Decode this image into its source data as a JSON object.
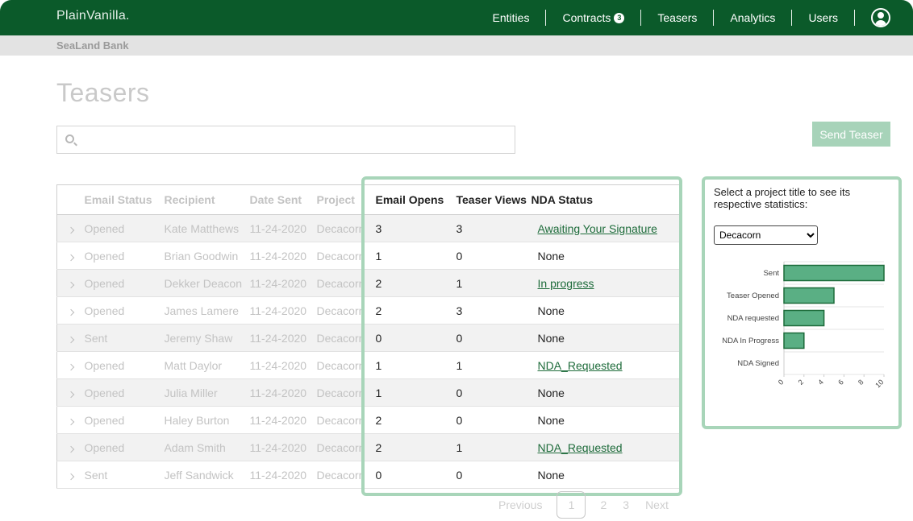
{
  "app": {
    "brand": "PlainVanilla."
  },
  "nav": {
    "links": [
      "Entities",
      "Contracts",
      "Teasers",
      "Analytics",
      "Users"
    ],
    "contracts_badge": "3"
  },
  "org": {
    "name": "SeaLand Bank"
  },
  "page": {
    "title": "Teasers"
  },
  "search": {
    "placeholder": "",
    "value": ""
  },
  "actions": {
    "send_teaser": "Send Teaser"
  },
  "table": {
    "columns": [
      "Email Status",
      "Recipient",
      "Date Sent",
      "Project",
      "Email Opens",
      "Teaser Views",
      "NDA Status"
    ],
    "rows": [
      {
        "status": "Opened",
        "recipient": "Kate Matthews",
        "date": "11-24-2020",
        "project": "Decacorn",
        "opens": "3",
        "views": "3",
        "nda": "Awaiting Your Signature",
        "nda_link": true
      },
      {
        "status": "Opened",
        "recipient": "Brian Goodwin",
        "date": "11-24-2020",
        "project": "Decacorn",
        "opens": "1",
        "views": "0",
        "nda": "None",
        "nda_link": false
      },
      {
        "status": "Opened",
        "recipient": "Dekker Deacon",
        "date": "11-24-2020",
        "project": "Decacorn",
        "opens": "2",
        "views": "1",
        "nda": "In progress",
        "nda_link": true
      },
      {
        "status": "Opened",
        "recipient": "James Lamere",
        "date": "11-24-2020",
        "project": "Decacorn",
        "opens": "2",
        "views": "3",
        "nda": "None",
        "nda_link": false
      },
      {
        "status": "Sent",
        "recipient": "Jeremy Shaw",
        "date": "11-24-2020",
        "project": "Decacorn",
        "opens": "0",
        "views": "0",
        "nda": "None",
        "nda_link": false
      },
      {
        "status": "Opened",
        "recipient": "Matt Daylor",
        "date": "11-24-2020",
        "project": "Decacorn",
        "opens": "1",
        "views": "1",
        "nda": "NDA_Requested",
        "nda_link": true
      },
      {
        "status": "Opened",
        "recipient": "Julia Miller",
        "date": "11-24-2020",
        "project": "Decacorn",
        "opens": "1",
        "views": "0",
        "nda": "None",
        "nda_link": false
      },
      {
        "status": "Opened",
        "recipient": "Haley Burton",
        "date": "11-24-2020",
        "project": "Decacorn",
        "opens": "2",
        "views": "0",
        "nda": "None",
        "nda_link": false
      },
      {
        "status": "Opened",
        "recipient": "Adam Smith",
        "date": "11-24-2020",
        "project": "Decacorn",
        "opens": "2",
        "views": "1",
        "nda": "NDA_Requested",
        "nda_link": true
      },
      {
        "status": "Sent",
        "recipient": "Jeff Sandwick",
        "date": "11-24-2020",
        "project": "Decacorn",
        "opens": "0",
        "views": "0",
        "nda": "None",
        "nda_link": false
      }
    ]
  },
  "pagination": {
    "previous": "Previous",
    "pages": [
      "1",
      "2",
      "3"
    ],
    "current": "1",
    "next": "Next"
  },
  "stats": {
    "prompt": "Select a project title to see its respective statistics:",
    "selected_project": "Decacorn"
  },
  "colors": {
    "nav_bg": "#0b5a2a",
    "highlight": "#a8d5b9",
    "bar_fill": "#5aaf84",
    "bar_stroke": "#1d6b3a",
    "link": "#1d6b3a"
  },
  "chart_data": {
    "type": "bar",
    "orientation": "horizontal",
    "categories": [
      "Sent",
      "Teaser Opened",
      "NDA requested",
      "NDA In Progress",
      "NDA Signed"
    ],
    "values": [
      10,
      5,
      4,
      2,
      0
    ],
    "xticks": [
      0,
      2,
      4,
      6,
      8,
      10
    ],
    "xlim": [
      0,
      10
    ],
    "grid": true
  }
}
